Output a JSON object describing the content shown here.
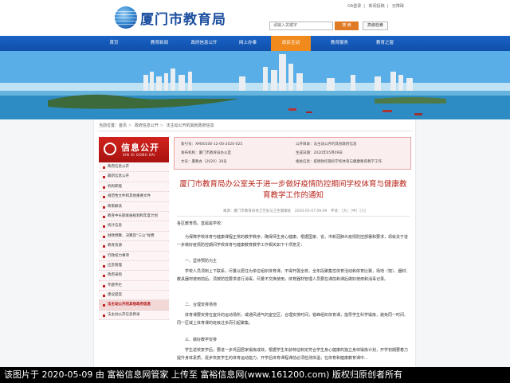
{
  "header": {
    "site_title": "厦门市教育局",
    "top_links": [
      "OA登录",
      "新闻投稿",
      "无障碍"
    ],
    "search_placeholder": "请输入关键字",
    "search_button": "搜 索",
    "advanced_search": "高级检索"
  },
  "nav": {
    "items": [
      "首页",
      "教育新闻",
      "政府信息公开",
      "网上办事",
      "政民互动",
      "教育服务",
      "教育之窗"
    ],
    "active_index": 2
  },
  "breadcrumb": [
    "当前位置：首页",
    "政府信息公开",
    "法主动公开的其他政府信息"
  ],
  "sidebar": {
    "title": "信息公开",
    "subtitle": "XIN XI GONG KAI",
    "items": [
      "政府信息公开",
      "最新信息公开",
      "机构职能",
      "规范性文件和其他重要文件",
      "政策解读",
      "教育中长期发展规划和年度计划",
      "统计信息",
      "财政预算、决算及“三公”经费",
      "教育资源",
      "行政权力事项",
      "应急管理",
      "政府采购",
      "专题专栏",
      "建议提案",
      "法主动公开的其他政府信息",
      "法主动公开信息目录"
    ],
    "active_index": 14
  },
  "info_box": {
    "index_no": "索引号：XM00106-12-00-2020-025",
    "category": "公开目录：法主动公开的其他政府信息",
    "publisher": "发布机构：厦门市教育局办公室",
    "date": "生成日期：2020年05月09日",
    "doc_no": "文号：厦教办〔2020〕30号",
    "topic": "相关信息：疫情防控期间学校体育与健康教育教学工作"
  },
  "article": {
    "title": "厦门市教育局办公室关于进一步做好疫情防控期间学校体育与健康教育教学工作的通知",
    "meta": "来源：厦门市教育局体卫艺处与卫生健康处　2020-05-07 09:09　字体：［大］［中］［小］",
    "salutation": "各区教育局，直属属学校：",
    "para1": "为保障学校体育与健康课程正常的教学秩序，确保师生身心健康，根据国家、省、市新冠肺炎疫情防控部署和要求，现就关于进一步做好疫情防控期间学校体育与健康教育教学工作相关如下十项意见：",
    "h1": "一、坚持预防为主",
    "para2": "学校人员须到上下联系，尽量以居住为单位组织体育课，不得开展全校、全年段聚集性体育活动和体育比赛，场地（馆）、器材、教具器材使用前后，须按防控要求进行消毒，尽量不交换使用，体育器材管理人员要在课前和课后做好使用和消毒记录。",
    "h2": "二、合理安排场地",
    "para3": "体育课要安排在室外的运动场所，或通风通气的室空区，合理安排时间，错峰组织体育课，指导学生科学锻炼，避免同一时间、同一区域上体育课的班级过多而引起聚集。",
    "h3": "三、做好教学安排",
    "para4": "学生返校复学后，要进一步巩固居家锻炼成效，根据学生年龄特征制定符合学生身心健康的独立身体锻炼计划，开学初期要着力提升身体素质，逐步恢复学生的体育运动能力，开学后体育课程课前必须检测体温，在体育和健康教育课中..."
  },
  "watermark": "该图片于 2020-05-09 由 富裕信息网管家 上传至 富裕信息网(www.161200.com) 版权归原创者所有"
}
